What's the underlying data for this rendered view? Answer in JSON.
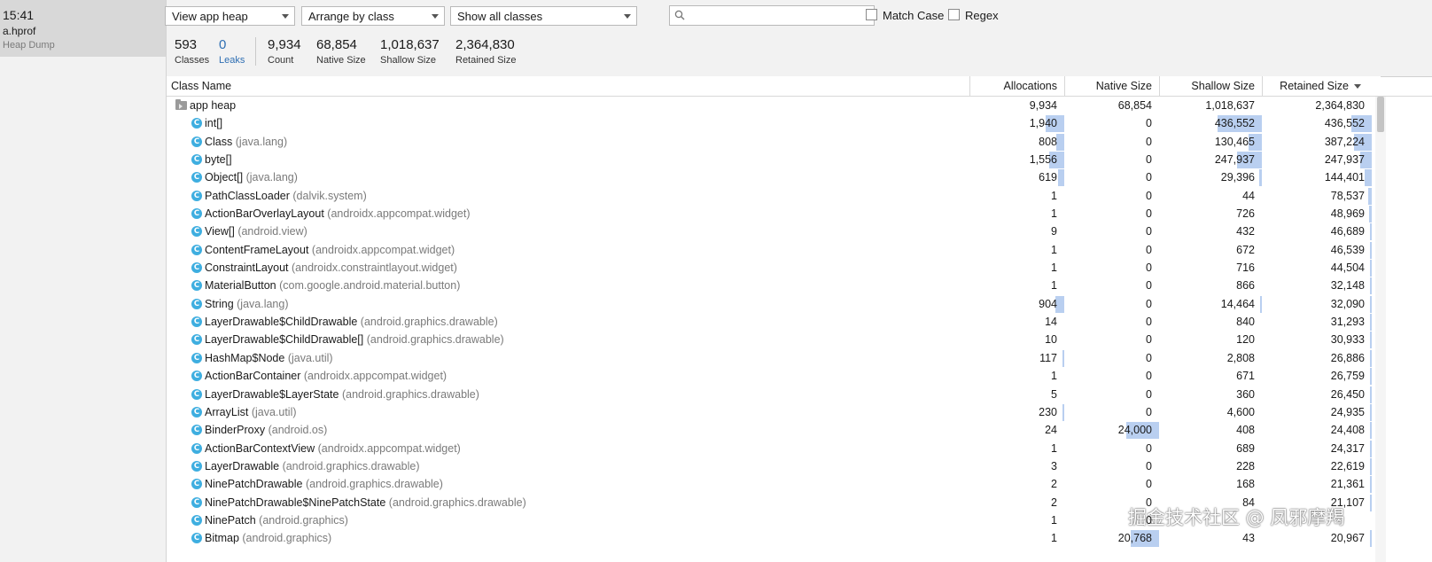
{
  "session": {
    "time": "15:41",
    "file": "a.hprof",
    "type": "Heap Dump"
  },
  "toolbar": {
    "heap_select": "View app heap",
    "arrange_select": "Arrange by class",
    "filter_select": "Show all classes",
    "search_placeholder": "",
    "match_case_label": "Match Case",
    "regex_label": "Regex"
  },
  "stats": [
    {
      "value": "593",
      "label": "Classes"
    },
    {
      "value": "0",
      "label": "Leaks"
    },
    {
      "value": "9,934",
      "label": "Count"
    },
    {
      "value": "68,854",
      "label": "Native Size"
    },
    {
      "value": "1,018,637",
      "label": "Shallow Size"
    },
    {
      "value": "2,364,830",
      "label": "Retained Size"
    }
  ],
  "table": {
    "headers": {
      "class_name": "Class Name",
      "allocations": "Allocations",
      "native_size": "Native Size",
      "shallow_size": "Shallow Size",
      "retained_size": "Retained Size"
    },
    "rows": [
      {
        "name": "app heap",
        "pkg": "",
        "root": true,
        "alloc": "9,934",
        "native": "68,854",
        "shallow": "1,018,637",
        "retained": "2,364,830"
      },
      {
        "name": "int[]",
        "pkg": "",
        "alloc": "1,940",
        "native": "0",
        "shallow": "436,552",
        "retained": "436,552",
        "alloc_frac": 0.195,
        "native_frac": 0,
        "shallow_frac": 0.429,
        "retained_frac": 0.185
      },
      {
        "name": "Class",
        "pkg": "(java.lang)",
        "alloc": "808",
        "native": "0",
        "shallow": "130,465",
        "retained": "387,224",
        "alloc_frac": 0.081,
        "native_frac": 0,
        "shallow_frac": 0.128,
        "retained_frac": 0.164
      },
      {
        "name": "byte[]",
        "pkg": "",
        "alloc": "1,556",
        "native": "0",
        "shallow": "247,937",
        "retained": "247,937",
        "alloc_frac": 0.157,
        "native_frac": 0,
        "shallow_frac": 0.243,
        "retained_frac": 0.105
      },
      {
        "name": "Object[]",
        "pkg": "(java.lang)",
        "alloc": "619",
        "native": "0",
        "shallow": "29,396",
        "retained": "144,401",
        "alloc_frac": 0.062,
        "native_frac": 0,
        "shallow_frac": 0.029,
        "retained_frac": 0.061
      },
      {
        "name": "PathClassLoader",
        "pkg": "(dalvik.system)",
        "alloc": "1",
        "native": "0",
        "shallow": "44",
        "retained": "78,537",
        "alloc_frac": 0,
        "native_frac": 0,
        "shallow_frac": 0,
        "retained_frac": 0.033
      },
      {
        "name": "ActionBarOverlayLayout",
        "pkg": "(androidx.appcompat.widget)",
        "alloc": "1",
        "native": "0",
        "shallow": "726",
        "retained": "48,969",
        "alloc_frac": 0,
        "native_frac": 0,
        "shallow_frac": 0,
        "retained_frac": 0.021
      },
      {
        "name": "View[]",
        "pkg": "(android.view)",
        "alloc": "9",
        "native": "0",
        "shallow": "432",
        "retained": "46,689",
        "alloc_frac": 0,
        "native_frac": 0,
        "shallow_frac": 0,
        "retained_frac": 0.02
      },
      {
        "name": "ContentFrameLayout",
        "pkg": "(androidx.appcompat.widget)",
        "alloc": "1",
        "native": "0",
        "shallow": "672",
        "retained": "46,539",
        "alloc_frac": 0,
        "native_frac": 0,
        "shallow_frac": 0,
        "retained_frac": 0.02
      },
      {
        "name": "ConstraintLayout",
        "pkg": "(androidx.constraintlayout.widget)",
        "alloc": "1",
        "native": "0",
        "shallow": "716",
        "retained": "44,504",
        "alloc_frac": 0,
        "native_frac": 0,
        "shallow_frac": 0,
        "retained_frac": 0.019
      },
      {
        "name": "MaterialButton",
        "pkg": "(com.google.android.material.button)",
        "alloc": "1",
        "native": "0",
        "shallow": "866",
        "retained": "32,148",
        "alloc_frac": 0,
        "native_frac": 0,
        "shallow_frac": 0,
        "retained_frac": 0.014
      },
      {
        "name": "String",
        "pkg": "(java.lang)",
        "alloc": "904",
        "native": "0",
        "shallow": "14,464",
        "retained": "32,090",
        "alloc_frac": 0.091,
        "native_frac": 0,
        "shallow_frac": 0.014,
        "retained_frac": 0.014
      },
      {
        "name": "LayerDrawable$ChildDrawable",
        "pkg": "(android.graphics.drawable)",
        "alloc": "14",
        "native": "0",
        "shallow": "840",
        "retained": "31,293",
        "alloc_frac": 0,
        "native_frac": 0,
        "shallow_frac": 0,
        "retained_frac": 0.013
      },
      {
        "name": "LayerDrawable$ChildDrawable[]",
        "pkg": "(android.graphics.drawable)",
        "alloc": "10",
        "native": "0",
        "shallow": "120",
        "retained": "30,933",
        "alloc_frac": 0,
        "native_frac": 0,
        "shallow_frac": 0,
        "retained_frac": 0.013
      },
      {
        "name": "HashMap$Node",
        "pkg": "(java.util)",
        "alloc": "117",
        "native": "0",
        "shallow": "2,808",
        "retained": "26,886",
        "alloc_frac": 0.012,
        "native_frac": 0,
        "shallow_frac": 0,
        "retained_frac": 0.011
      },
      {
        "name": "ActionBarContainer",
        "pkg": "(androidx.appcompat.widget)",
        "alloc": "1",
        "native": "0",
        "shallow": "671",
        "retained": "26,759",
        "alloc_frac": 0,
        "native_frac": 0,
        "shallow_frac": 0,
        "retained_frac": 0.011
      },
      {
        "name": "LayerDrawable$LayerState",
        "pkg": "(android.graphics.drawable)",
        "alloc": "5",
        "native": "0",
        "shallow": "360",
        "retained": "26,450",
        "alloc_frac": 0,
        "native_frac": 0,
        "shallow_frac": 0,
        "retained_frac": 0.011
      },
      {
        "name": "ArrayList",
        "pkg": "(java.util)",
        "alloc": "230",
        "native": "0",
        "shallow": "4,600",
        "retained": "24,935",
        "alloc_frac": 0.023,
        "native_frac": 0,
        "shallow_frac": 0,
        "retained_frac": 0.011
      },
      {
        "name": "BinderProxy",
        "pkg": "(android.os)",
        "alloc": "24",
        "native": "24,000",
        "shallow": "408",
        "retained": "24,408",
        "alloc_frac": 0,
        "native_frac": 0.349,
        "shallow_frac": 0,
        "retained_frac": 0.01
      },
      {
        "name": "ActionBarContextView",
        "pkg": "(androidx.appcompat.widget)",
        "alloc": "1",
        "native": "0",
        "shallow": "689",
        "retained": "24,317",
        "alloc_frac": 0,
        "native_frac": 0,
        "shallow_frac": 0,
        "retained_frac": 0.01
      },
      {
        "name": "LayerDrawable",
        "pkg": "(android.graphics.drawable)",
        "alloc": "3",
        "native": "0",
        "shallow": "228",
        "retained": "22,619",
        "alloc_frac": 0,
        "native_frac": 0,
        "shallow_frac": 0,
        "retained_frac": 0.01
      },
      {
        "name": "NinePatchDrawable",
        "pkg": "(android.graphics.drawable)",
        "alloc": "2",
        "native": "0",
        "shallow": "168",
        "retained": "21,361",
        "alloc_frac": 0,
        "native_frac": 0,
        "shallow_frac": 0,
        "retained_frac": 0.009
      },
      {
        "name": "NinePatchDrawable$NinePatchState",
        "pkg": "(android.graphics.drawable)",
        "alloc": "2",
        "native": "0",
        "shallow": "84",
        "retained": "21,107",
        "alloc_frac": 0,
        "native_frac": 0,
        "shallow_frac": 0,
        "retained_frac": 0.009
      },
      {
        "name": "NinePatch",
        "pkg": "(android.graphics)",
        "alloc": "1",
        "native": "0",
        "shallow": "",
        "retained": "",
        "alloc_frac": 0,
        "native_frac": 0,
        "shallow_frac": 0,
        "retained_frac": 0
      },
      {
        "name": "Bitmap",
        "pkg": "(android.graphics)",
        "alloc": "1",
        "native": "20,768",
        "shallow": "43",
        "retained": "20,967",
        "alloc_frac": 0,
        "native_frac": 0.302,
        "shallow_frac": 0,
        "retained_frac": 0.009
      }
    ]
  },
  "watermark": "掘金技术社区 @ 凤邪摩羯",
  "colors": {
    "bar": "#b9cff0",
    "class_icon": "#3eaee0",
    "leaks": "#2f6fb3"
  },
  "icons": {
    "class": "class-icon",
    "root": "folder-icon",
    "search": "search-icon"
  }
}
